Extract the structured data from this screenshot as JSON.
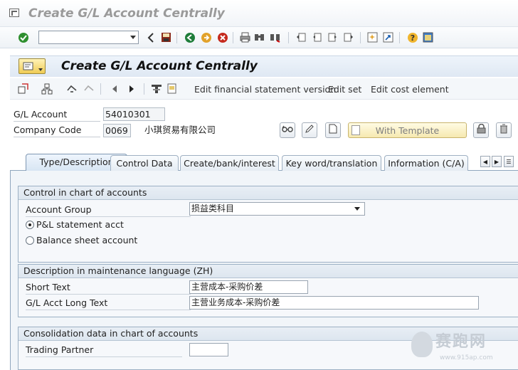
{
  "window": {
    "title": "Create G/L Account Centrally"
  },
  "system_toolbar": {
    "command_field_value": "",
    "icons": [
      "enter-icon",
      "back-icon",
      "save-icon",
      "back-green-icon",
      "exit-icon",
      "cancel-icon",
      "print-icon",
      "find-icon",
      "find-next-icon",
      "first-page-icon",
      "previous-page-icon",
      "next-page-icon",
      "last-page-icon",
      "new-session-icon",
      "shortcut-icon",
      "help-icon",
      "customize-layout-icon"
    ]
  },
  "screen": {
    "title": "Create G/L Account Centrally"
  },
  "app_toolbar": {
    "edit_fs_version": "Edit financial statement version",
    "edit_set": "Edit set",
    "edit_cost_element": "Edit cost element"
  },
  "header": {
    "gl_account_label": "G/L Account",
    "gl_account_value": "54010301",
    "company_code_label": "Company Code",
    "company_code_value": "0069",
    "company_name": "小琪贸易有限公司",
    "with_template_label": "With Template"
  },
  "tabs": [
    {
      "label": "Type/Description",
      "active": true
    },
    {
      "label": "Control Data",
      "active": false
    },
    {
      "label": "Create/bank/interest",
      "active": false
    },
    {
      "label": "Key word/translation",
      "active": false
    },
    {
      "label": "Information (C/A)",
      "active": false
    }
  ],
  "control_group": {
    "title": "Control in chart of accounts",
    "account_group_label": "Account Group",
    "account_group_value": "损益类科目",
    "pl_label": "P&L statement acct",
    "pl_selected": true,
    "bs_label": "Balance sheet account",
    "bs_selected": false
  },
  "description_group": {
    "title": "Description in maintenance language (ZH)",
    "short_text_label": "Short Text",
    "short_text_value": "主营成本-采购价差",
    "long_text_label": "G/L Acct Long Text",
    "long_text_value": "主营业务成本-采购价差"
  },
  "consolidation_group": {
    "title": "Consolidation data in chart of accounts",
    "trading_partner_label": "Trading Partner",
    "trading_partner_value": ""
  },
  "watermark": {
    "text": "赛跑网",
    "url": "www.915ap.com"
  },
  "colors": {
    "header_bg": "#dfe8f3",
    "tab_active_bg": "#d7e5f3",
    "template_button": "#f6e9b0"
  }
}
